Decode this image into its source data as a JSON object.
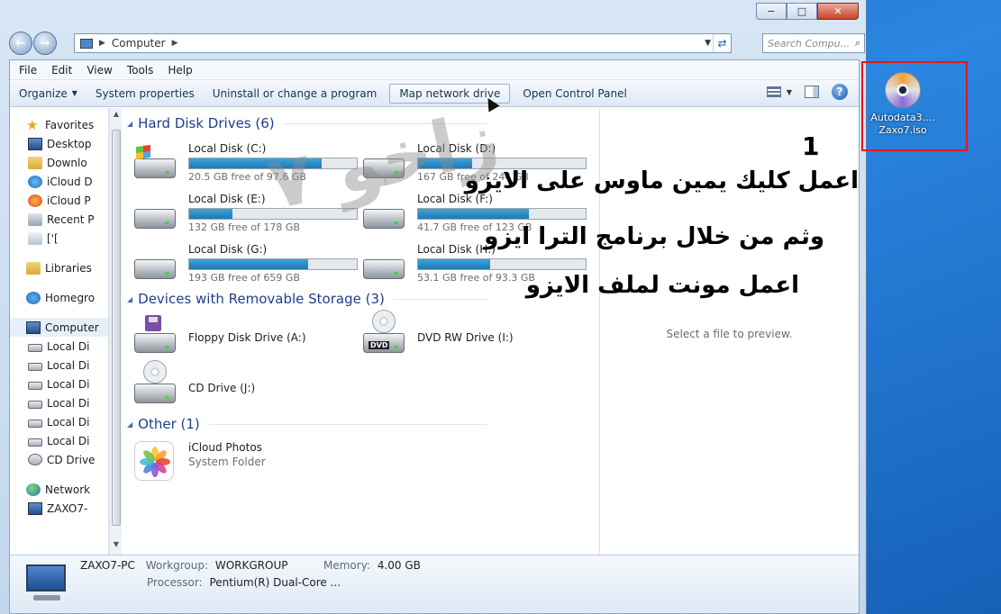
{
  "window": {
    "minimize_icon": "minimize-icon",
    "maximize_icon": "maximize-icon",
    "close_icon": "close-icon"
  },
  "address": {
    "root": "Computer",
    "search_placeholder": "Search Compu..."
  },
  "menu": [
    "File",
    "Edit",
    "View",
    "Tools",
    "Help"
  ],
  "toolbar": {
    "organize": "Organize",
    "system_properties": "System properties",
    "uninstall": "Uninstall or change a program",
    "map_drive": "Map network drive",
    "control_panel": "Open Control Panel"
  },
  "nav": {
    "favorites": "Favorites",
    "fav_items": [
      "Desktop",
      "Downlo",
      "iCloud D",
      "iCloud P",
      "Recent P",
      "['["
    ],
    "libraries": "Libraries",
    "homegroup": "Homegro",
    "computer": "Computer",
    "computer_items": [
      "Local Di",
      "Local Di",
      "Local Di",
      "Local Di",
      "Local Di",
      "Local Di",
      "CD Drive"
    ],
    "network": "Network",
    "network_items": [
      "ZAXO7-"
    ]
  },
  "groups": {
    "hdd": "Hard Disk Drives (6)",
    "removable": "Devices with Removable Storage (3)",
    "other": "Other (1)"
  },
  "drives": [
    {
      "name": "Local Disk (C:)",
      "free": "20.5 GB free of 97.6 GB",
      "used_fraction": 0.79
    },
    {
      "name": "Local Disk (D:)",
      "free": "167 GB free of 244 GB",
      "used_fraction": 0.32
    },
    {
      "name": "Local Disk (E:)",
      "free": "132 GB free of 178 GB",
      "used_fraction": 0.26
    },
    {
      "name": "Local Disk (F:)",
      "free": "41.7 GB free of 123 GB",
      "used_fraction": 0.66
    },
    {
      "name": "Local Disk (G:)",
      "free": "193 GB free of 659 GB",
      "used_fraction": 0.71
    },
    {
      "name": "Local Disk (H:)",
      "free": "53.1 GB free of 93.3 GB",
      "used_fraction": 0.43
    }
  ],
  "removable": [
    {
      "name": "Floppy Disk Drive (A:)",
      "icon": "floppy-drive-icon"
    },
    {
      "name": "DVD RW Drive (I:)",
      "icon": "dvd-drive-icon",
      "badge": "DVD"
    },
    {
      "name": "CD Drive (J:)",
      "icon": "cd-drive-icon"
    }
  ],
  "other": {
    "name": "iCloud Photos",
    "sub": "System Folder"
  },
  "preview": "Select a file to preview.",
  "details": {
    "pc_name": "ZAXO7-PC",
    "workgroup_label": "Workgroup:",
    "workgroup": "WORKGROUP",
    "memory_label": "Memory:",
    "memory": "4.00 GB",
    "processor_label": "Processor:",
    "processor": "Pentium(R) Dual-Core ..."
  },
  "overlay": {
    "step": "1",
    "line1": "اعمل كليك يمين ماوس على الايزو",
    "line2": "وثم من خلال برنامج الترا ايزو",
    "line3": "اعمل  مونت  لملف الايزو",
    "watermark": "زاخو ٧"
  },
  "desktop_file": {
    "line1": "Autodata3....",
    "line2": "Zaxo7.iso"
  }
}
